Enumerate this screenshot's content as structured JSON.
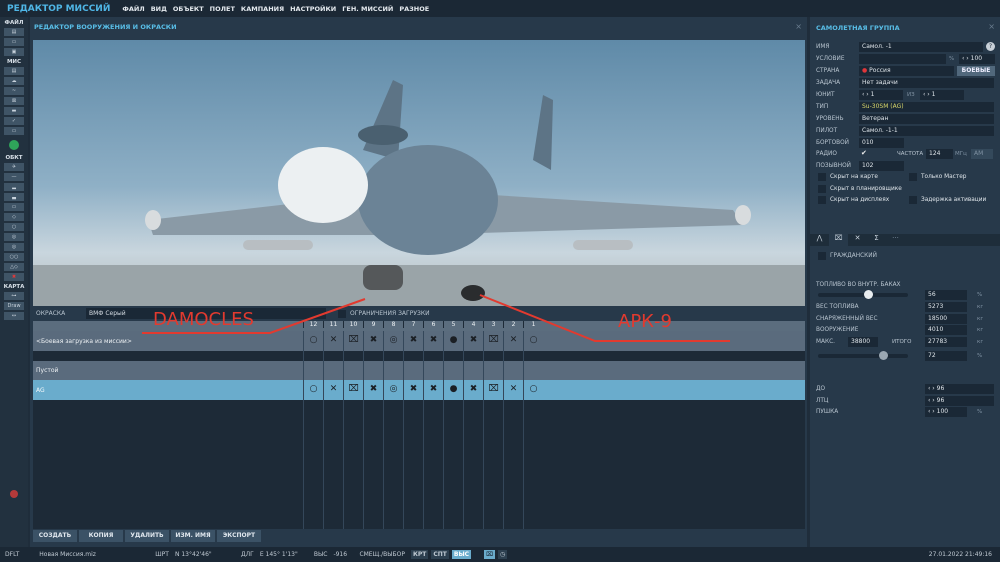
{
  "app_title": "РЕДАКТОР МИССИЙ",
  "menu": [
    "ФАЙЛ",
    "ВИД",
    "ОБЪЕКТ",
    "ПОЛЕТ",
    "КАМПАНИЯ",
    "НАСТРОЙКИ",
    "ГЕН. МИССИЙ",
    "РАЗНОЕ"
  ],
  "toolbar": {
    "file_label": "ФАЙЛ",
    "mis_label": "МИС",
    "obj_label": "ОБКТ",
    "map_label": "КАРТА",
    "map_btn": "Draw"
  },
  "editor": {
    "title": "РЕДАКТОР ВООРУЖЕНИЯ И ОКРАСКИ",
    "annotations": [
      "DAMOCLES",
      "АРК-9"
    ],
    "paint_label": "ОКРАСКА",
    "paint_value": "ВМФ Серый",
    "restrict_label": "ОГРАНИЧЕНИЯ ЗАГРУЗКИ",
    "pylons": [
      "12",
      "11",
      "10",
      "9",
      "8",
      "7",
      "6",
      "5",
      "4",
      "3",
      "2",
      "1"
    ],
    "slot_icons": [
      "circle-icon",
      "x-icon",
      "boxed-x-icon",
      "bomb-x-icon",
      "pod-icon",
      "quad-x-icon",
      "quad-x-icon",
      "pod-down-icon",
      "bomb-x-icon",
      "boxed-x-icon",
      "x-icon",
      "circle-icon"
    ],
    "slot_glyphs": [
      "○",
      "✕",
      "⌧",
      "✖",
      "◎",
      "✖",
      "✖",
      "●",
      "✖",
      "⌧",
      "✕",
      "○"
    ],
    "rows": [
      {
        "name": "<Боевая загрузка из миссии>"
      },
      {
        "name": "Пустой"
      },
      {
        "name": "AG",
        "selected": true
      }
    ],
    "buttons": [
      "СОЗДАТЬ",
      "КОПИЯ",
      "УДАЛИТЬ",
      "ИЗМ. ИМЯ",
      "ЭКСПОРТ"
    ]
  },
  "group": {
    "title": "САМОЛЕТНАЯ ГРУППА",
    "name_label": "ИМЯ",
    "name": "Самол. -1",
    "cond_label": "УСЛОВИЕ",
    "cond_value": "",
    "cond_unit": "%",
    "cond_pct": "100",
    "country_label": "СТРАНА",
    "country": "Россия",
    "combat_btn": "БОЕВЫЕ",
    "task_label": "ЗАДАЧА",
    "task": "Нет задачи",
    "unit_label": "ЮНИТ",
    "unit": "1",
    "of_label": "ИЗ",
    "unit_total": "1",
    "type_label": "ТИП",
    "type": "Su-30SM (AG)",
    "skill_label": "УРОВЕНЬ",
    "skill": "Ветеран",
    "pilot_label": "ПИЛОТ",
    "pilot": "Самол. -1-1",
    "board_label": "БОРТОВОЙ",
    "board": "010",
    "radio_label": "РАДИО",
    "radio_check": "✔",
    "freq_label": "ЧАСТОТА",
    "freq": "124",
    "freq_unit": "МГц",
    "mod": "AM",
    "callsign_label": "ПОЗЫВНОЙ",
    "callsign": "102",
    "checks": [
      "Скрыт на карте",
      "Только Мастер",
      "Скрыт в планировщике",
      "Скрыт на дисплеях",
      "Задержка активации"
    ]
  },
  "payload": {
    "tabs": [
      "route-icon",
      "payload-icon",
      "triggers-icon",
      "summary-icon",
      "more-icon"
    ],
    "civil_label": "ГРАЖДАНСКИЙ",
    "fuel_label": "ТОПЛИВО ВО ВНУТР. БАКАХ",
    "fuel_pct": "56",
    "fuel_fraction": 0.56,
    "fuel_weight_label": "ВЕС ТОПЛИВА",
    "fuel_weight": "5273",
    "empty_label": "СНАРЯЖЕННЫЙ ВЕС",
    "empty": "18500",
    "weapons_label": "ВООРУЖЕНИЕ",
    "weapons": "4010",
    "max_label": "МАКС.",
    "max": "38800",
    "total_label": "ИТОГО",
    "total": "27783",
    "total_pct": "72",
    "total_fraction": 0.72,
    "kg": "кг",
    "pct": "%",
    "chaff_label": "ДО",
    "chaff": "96",
    "flare_label": "ЛТЦ",
    "flare": "96",
    "gun_label": "ПУШКА",
    "gun": "100"
  },
  "status": {
    "profile": "DFLT",
    "file": "Новая Миссия.miz",
    "lat_label": "ШРТ",
    "lat": "N 13°42'46\"",
    "lon_label": "ДЛГ",
    "lon": "E 145° 1'13\"",
    "alt_label": "ВЫС",
    "alt": "-916",
    "offset_label": "СМЕЩ./ВЫБОР",
    "crt": "КРТ",
    "spt": "СПТ",
    "vys": "ВЫС",
    "datetime": "27.01.2022 21:49:16"
  },
  "colors": {
    "accent": "#4fb6e6",
    "selected_row": "#6aaccc",
    "annotation": "#e23a2f"
  }
}
